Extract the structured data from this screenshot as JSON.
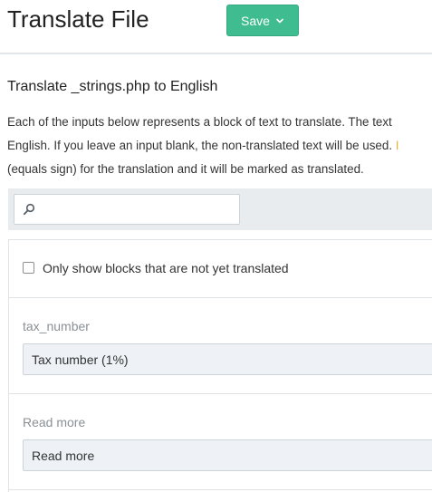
{
  "header": {
    "title": "Translate File",
    "save_label": "Save",
    "save_dropdown_icon": "chevron-down-icon"
  },
  "intro": {
    "heading": "Translate _strings.php to English",
    "line1": "Each of the inputs below represents a block of text to translate. The text",
    "line2_main": "English. If you leave an input blank, the non-translated text will be used. ",
    "line2_accent": "I",
    "line3": "(equals sign) for the translation and it will be marked as translated."
  },
  "search": {
    "icon": "search-icon",
    "placeholder": "",
    "value": ""
  },
  "filter": {
    "label": "Only show blocks that are not yet translated",
    "checked": false
  },
  "blocks": [
    {
      "label": "tax_number",
      "value": "Tax number (1%)"
    },
    {
      "label": "Read more",
      "value": "Read more"
    }
  ],
  "colors": {
    "accent": "#3fbd91",
    "input_bg": "#eef2f6",
    "toolbar_bg": "#e9ecef",
    "muted_label": "#8a9096",
    "warning_text": "#e0b23a"
  }
}
